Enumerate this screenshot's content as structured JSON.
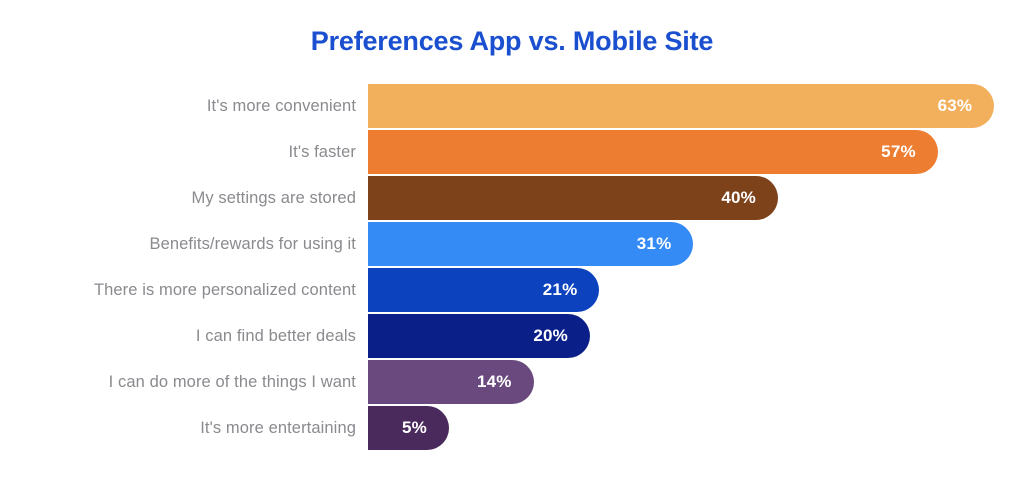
{
  "chart": {
    "title": "Preferences App vs. Mobile Site",
    "title_color": "#1a4fcf",
    "background_color": "#ffffff",
    "label_color": "#8a8a8f",
    "value_label_color": "#ffffff"
  },
  "chart_data": {
    "type": "bar",
    "orientation": "horizontal",
    "title": "Preferences App vs. Mobile Site",
    "xlabel": "",
    "ylabel": "",
    "xlim": [
      0,
      70
    ],
    "grid": false,
    "legend": "none",
    "value_suffix": "%",
    "categories": [
      "It's more convenient",
      "It's faster",
      "My settings are stored",
      "Benefits/rewards for using it",
      "There is more personalized content",
      "I can find better deals",
      "I can do more of the things I want",
      "It's more entertaining"
    ],
    "values": [
      63,
      57,
      40,
      31,
      21,
      20,
      14,
      5
    ],
    "value_labels": [
      "63%",
      "57%",
      "40%",
      "31%",
      "21%",
      "20%",
      "14%",
      "5%"
    ],
    "colors": [
      "#f2af5c",
      "#ed7d31",
      "#7e421a",
      "#358bf5",
      "#0c42be",
      "#0a2088",
      "#69497e",
      "#4a2a5c"
    ]
  }
}
